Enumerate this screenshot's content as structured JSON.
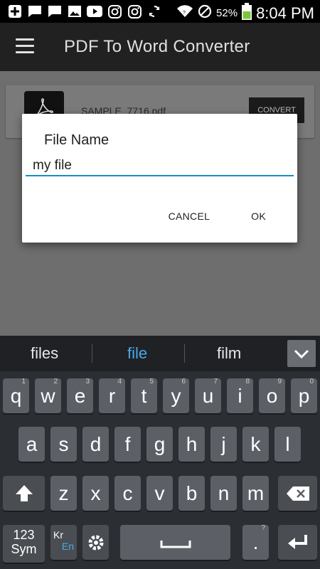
{
  "status_bar": {
    "battery": "52%",
    "time": "8:04 PM",
    "icons": [
      "add-icon",
      "chat-icon",
      "chat-icon",
      "image-icon",
      "youtube-icon",
      "instagram-icon",
      "instagram-icon",
      "sync-icon",
      "wifi-icon",
      "blocked-icon",
      "battery-icon"
    ]
  },
  "app_bar": {
    "title": "PDF To Word Converter",
    "menu_icon": "menu-icon"
  },
  "file_card": {
    "file_name": "SAMPLE_7716.pdf",
    "convert_label": "CONVERT"
  },
  "dialog": {
    "title": "File Name",
    "input_value": "my file",
    "cancel_label": "CANCEL",
    "ok_label": "OK"
  },
  "suggestions": {
    "items": [
      "files",
      "file",
      "film"
    ],
    "active_index": 1,
    "accent": "#4aa8ea"
  },
  "keyboard": {
    "row1": [
      {
        "key": "q",
        "hint": "1"
      },
      {
        "key": "w",
        "hint": "2"
      },
      {
        "key": "e",
        "hint": "3"
      },
      {
        "key": "r",
        "hint": "4"
      },
      {
        "key": "t",
        "hint": "5"
      },
      {
        "key": "y",
        "hint": "6"
      },
      {
        "key": "u",
        "hint": "7"
      },
      {
        "key": "i",
        "hint": "8"
      },
      {
        "key": "o",
        "hint": "9"
      },
      {
        "key": "p",
        "hint": "0"
      }
    ],
    "row2": [
      "a",
      "s",
      "d",
      "f",
      "g",
      "h",
      "j",
      "k",
      "l"
    ],
    "row3": [
      "z",
      "x",
      "c",
      "v",
      "b",
      "n",
      "m"
    ],
    "sym_label_1": "123",
    "sym_label_2": "Sym",
    "lang_label_1": "Kr",
    "lang_label_2": "En",
    "period": ".",
    "period_hint": "?"
  },
  "colors": {
    "accent_blue": "#1e88c7",
    "app_bar": "#212121",
    "keyboard_bg": "#2b2e33"
  }
}
